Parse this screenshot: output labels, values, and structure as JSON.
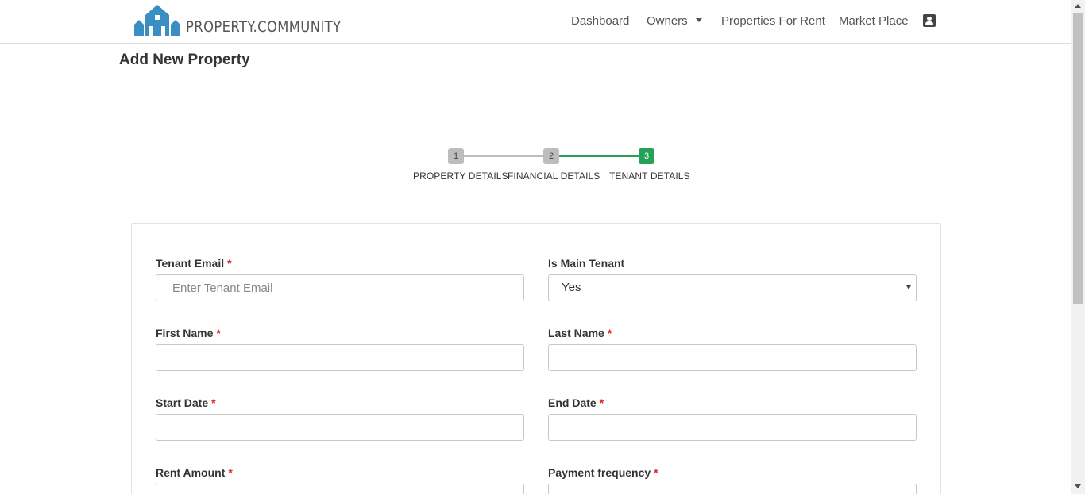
{
  "brand": {
    "name": "PROPERTY.COMMUNITY",
    "logo_color": "#3a8ec3"
  },
  "nav": {
    "dashboard": "Dashboard",
    "owners": "Owners",
    "properties_for_rent": "Properties For Rent",
    "market_place": "Market Place",
    "profile_icon": "contact-card-icon"
  },
  "page": {
    "title": "Add New Property"
  },
  "stepper": {
    "steps": [
      {
        "number": "1",
        "label": "PROPERTY DETAILS",
        "state": "done"
      },
      {
        "number": "2",
        "label": "FINANCIAL DETAILS",
        "state": "done"
      },
      {
        "number": "3",
        "label": "TENANT DETAILS",
        "state": "active"
      }
    ],
    "active_color": "#27a155",
    "inactive_color": "#bdbdbd"
  },
  "form": {
    "tenant_email": {
      "label": "Tenant Email",
      "required": "*",
      "placeholder": "Enter Tenant Email",
      "value": ""
    },
    "is_main_tenant": {
      "label": "Is Main Tenant",
      "selected": "Yes"
    },
    "first_name": {
      "label": "First Name",
      "required": "*",
      "value": ""
    },
    "last_name": {
      "label": "Last Name",
      "required": "*",
      "value": ""
    },
    "start_date": {
      "label": "Start Date",
      "required": "*",
      "value": ""
    },
    "end_date": {
      "label": "End Date",
      "required": "*",
      "value": ""
    },
    "rent_amount": {
      "label": "Rent Amount",
      "required": "*"
    },
    "payment_frequency": {
      "label": "Payment frequency",
      "required": "*"
    }
  }
}
